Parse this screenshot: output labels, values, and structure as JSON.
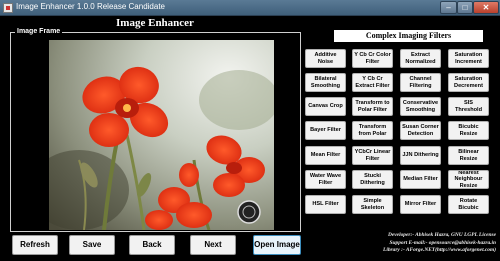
{
  "window": {
    "title": "Image Enhancer 1.0.0 Release Candidate",
    "minimize_glyph": "–",
    "maximize_glyph": "□",
    "close_glyph": "✕"
  },
  "app": {
    "heading": "Image Enhancer",
    "frame_label": "Image Frame"
  },
  "filters": {
    "title": "Complex Imaging Filters",
    "buttons": [
      [
        "Additive Noise",
        "Y Cb Cr Color Filter",
        "Extract Normalized",
        "Saturation Increment"
      ],
      [
        "Bilateral Smoothing",
        "Y Cb Cr Extract Filter",
        "Channel Filtering",
        "Saturation Decrement"
      ],
      [
        "Canvas Crop",
        "Transform to Polar Filter",
        "Conservative Smoothing",
        "SIS Threshold"
      ],
      [
        "Bayer Filter",
        "Transform from Polar",
        "Susan Corner Detection",
        "Bicubic Resize"
      ],
      [
        "Mean Filter",
        "YCbCr Linear Filter",
        "JJN Dithering",
        "Bilinear Resize"
      ],
      [
        "Water Wave Filter",
        "Stucki Dithering",
        "Median Filter",
        "Nearest Neighbour Resize"
      ],
      [
        "HSL Filter",
        "Simple Skeleton",
        "Mirror Filter",
        "Rotate Bicubic"
      ]
    ]
  },
  "nav": {
    "refresh": "Refresh",
    "save": "Save",
    "back": "Back",
    "next": "Next",
    "open": "Open Image"
  },
  "developer": {
    "line1": "Developer:- Abhisek Hazra, GNU LGPL License",
    "line2": "Support E-mail:- opensource@abhisek-hazra.in",
    "line3": "Library :- AForge.NET(http://www.aforgenet.com)"
  },
  "colors": {
    "flower": "#e8381a",
    "stem": "#6f7a3a",
    "background": "#000000"
  }
}
